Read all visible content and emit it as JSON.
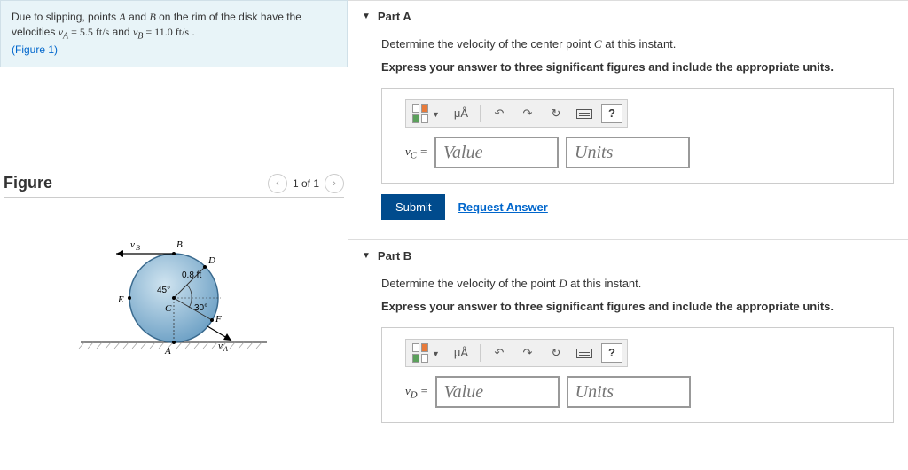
{
  "problem": {
    "line1_prefix": "Due to slipping, points ",
    "line1_A": "A",
    "line1_and": " and ",
    "line1_B": "B",
    "line1_rest": " on the rim of the disk have the velocities ",
    "vA_expr": "vA = 5.5 ft/s",
    "and2": " and ",
    "vB_expr": "vB = 11.0 ft/s",
    "period": " .",
    "figure_link": "(Figure 1)"
  },
  "figure": {
    "title": "Figure",
    "nav_text": "1 of 1",
    "labels": {
      "vB": "vB",
      "B": "B",
      "D": "D",
      "r": "0.8 ft",
      "a45": "45°",
      "E": "E",
      "C": "C",
      "a30": "30°",
      "F": "F",
      "A": "A",
      "vA": "vA"
    }
  },
  "partA": {
    "title": "Part A",
    "prompt_pre": "Determine the velocity of the center point ",
    "prompt_pt": "C",
    "prompt_post": " at this instant.",
    "instr": "Express your answer to three significant figures and include the appropriate units.",
    "label": "vC =",
    "value_ph": "Value",
    "units_ph": "Units",
    "muA": "μÅ",
    "submit": "Submit",
    "request": "Request Answer"
  },
  "partB": {
    "title": "Part B",
    "prompt_pre": "Determine the velocity of the point ",
    "prompt_pt": "D",
    "prompt_post": " at this instant.",
    "instr": "Express your answer to three significant figures and include the appropriate units.",
    "label": "vD =",
    "value_ph": "Value",
    "units_ph": "Units",
    "muA": "μÅ"
  }
}
